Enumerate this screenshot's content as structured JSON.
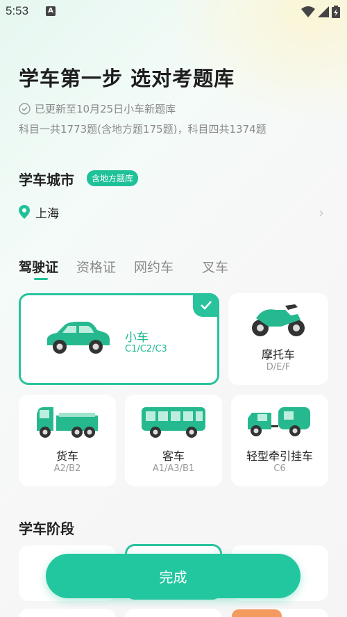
{
  "status_bar": {
    "time": "5:53",
    "notification_icon": "A"
  },
  "header": {
    "title": "学车第一步 选对考题库",
    "update_text": "已更新至10月25日小车新题库",
    "count_text": "科目一共1773题(含地方题175题)，科目四共1374题"
  },
  "city_section": {
    "title": "学车城市",
    "badge": "含地方题库",
    "city": "上海"
  },
  "tabs": [
    {
      "label": "驾驶证",
      "active": true
    },
    {
      "label": "资格证",
      "active": false
    },
    {
      "label": "网约车",
      "active": false
    },
    {
      "label": "叉车",
      "active": false
    }
  ],
  "vehicles": [
    {
      "name": "小车",
      "code": "C1/C2/C3",
      "selected": true,
      "icon": "car-icon"
    },
    {
      "name": "摩托车",
      "code": "D/E/F",
      "selected": false,
      "icon": "motorcycle-icon"
    },
    {
      "name": "货车",
      "code": "A2/B2",
      "selected": false,
      "icon": "truck-icon"
    },
    {
      "name": "客车",
      "code": "A1/A3/B1",
      "selected": false,
      "icon": "bus-icon"
    },
    {
      "name": "轻型牵引挂车",
      "code": "C6",
      "selected": false,
      "icon": "trailer-icon"
    }
  ],
  "stage_section": {
    "title": "学车阶段"
  },
  "done_button": {
    "label": "完成"
  },
  "colors": {
    "accent": "#23c79f",
    "text": "#222222",
    "muted": "#8a8a8a",
    "orange": "#f39a5f"
  }
}
